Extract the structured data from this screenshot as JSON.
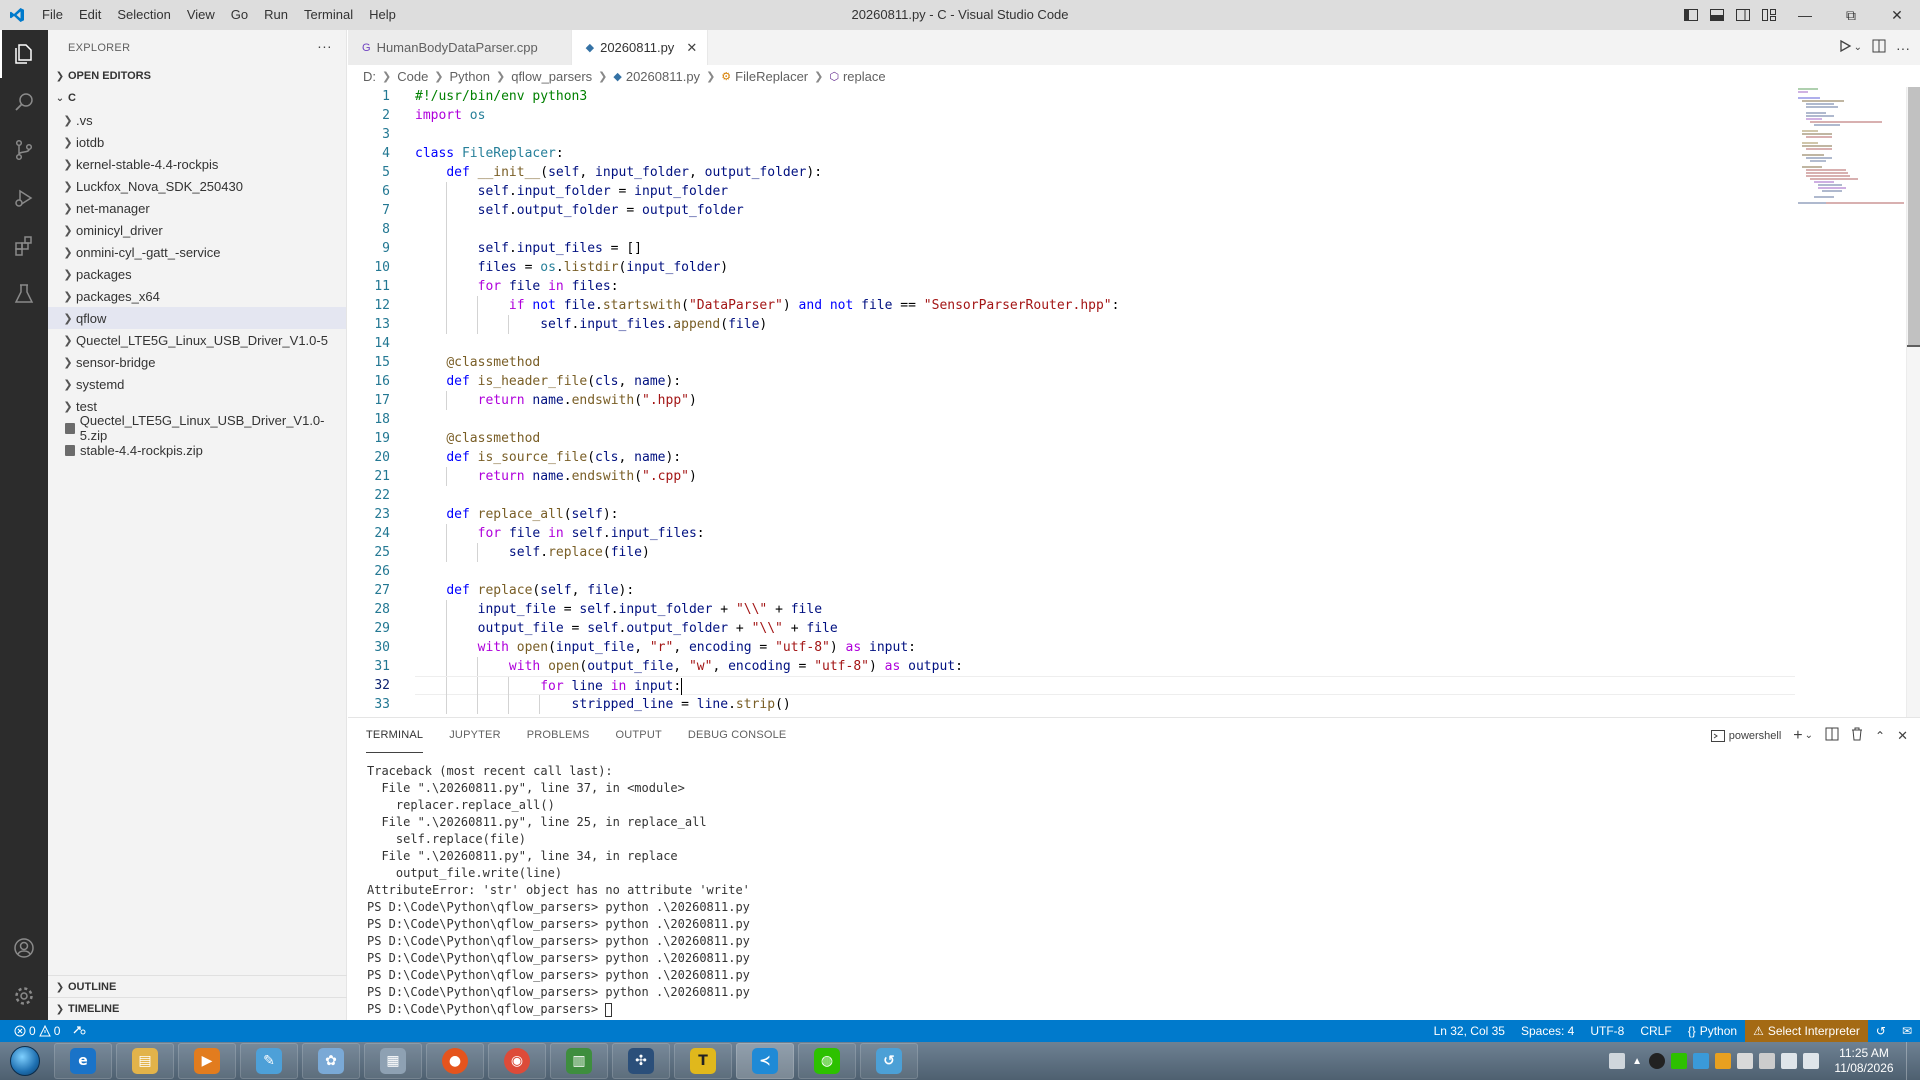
{
  "window": {
    "title": "20260811.py - C - Visual Studio Code",
    "menu": [
      "File",
      "Edit",
      "Selection",
      "View",
      "Go",
      "Run",
      "Terminal",
      "Help"
    ]
  },
  "activity_bar": {
    "items": [
      "files-icon",
      "search-icon",
      "source-control-icon",
      "run-debug-icon",
      "extensions-icon",
      "testing-icon"
    ],
    "bottom": [
      "account-icon",
      "manage-gear-icon"
    ]
  },
  "sidebar": {
    "title": "EXPLORER",
    "more": "···",
    "open_editors": "OPEN EDITORS",
    "root": "C",
    "items": [
      {
        "label": ".vs",
        "type": "folder"
      },
      {
        "label": "iotdb",
        "type": "folder"
      },
      {
        "label": "kernel-stable-4.4-rockpis",
        "type": "folder"
      },
      {
        "label": "Luckfox_Nova_SDK_250430",
        "type": "folder"
      },
      {
        "label": "net-manager",
        "type": "folder"
      },
      {
        "label": "ominicyl_driver",
        "type": "folder"
      },
      {
        "label": "onmini-cyl_-gatt_-service",
        "type": "folder"
      },
      {
        "label": "packages",
        "type": "folder"
      },
      {
        "label": "packages_x64",
        "type": "folder"
      },
      {
        "label": "qflow",
        "type": "folder",
        "selected": true
      },
      {
        "label": "Quectel_LTE5G_Linux_USB_Driver_V1.0-5",
        "type": "folder"
      },
      {
        "label": "sensor-bridge",
        "type": "folder"
      },
      {
        "label": "systemd",
        "type": "folder"
      },
      {
        "label": "test",
        "type": "folder"
      },
      {
        "label": "Quectel_LTE5G_Linux_USB_Driver_V1.0-5.zip",
        "type": "file"
      },
      {
        "label": "stable-4.4-rockpis.zip",
        "type": "file"
      }
    ],
    "outline": "OUTLINE",
    "timeline": "TIMELINE"
  },
  "tabs": [
    {
      "label": "HumanBodyDataParser.cpp",
      "active": false,
      "icon": "G"
    },
    {
      "label": "20260811.py",
      "active": true,
      "icon": "◆",
      "close": "✕"
    }
  ],
  "breadcrumb": [
    "D:",
    "Code",
    "Python",
    "qflow_parsers",
    "20260811.py",
    "FileReplacer",
    "replace"
  ],
  "editor": {
    "line_numbers": [
      "1",
      "2",
      "3",
      "4",
      "5",
      "6",
      "7",
      "8",
      "9",
      "10",
      "11",
      "12",
      "13",
      "14",
      "15",
      "16",
      "17",
      "18",
      "19",
      "20",
      "21",
      "22",
      "23",
      "24",
      "25",
      "26",
      "27",
      "28",
      "29",
      "30",
      "31",
      "32",
      "33"
    ],
    "current_line": 32
  },
  "panel": {
    "tabs": [
      "TERMINAL",
      "JUPYTER",
      "PROBLEMS",
      "OUTPUT",
      "DEBUG CONSOLE"
    ],
    "shell": "powershell",
    "terminal_lines": [
      "Traceback (most recent call last):",
      "  File \".\\20260811.py\", line 37, in <module>",
      "    replacer.replace_all()",
      "  File \".\\20260811.py\", line 25, in replace_all",
      "    self.replace(file)",
      "  File \".\\20260811.py\", line 34, in replace",
      "    output_file.write(line)",
      "AttributeError: 'str' object has no attribute 'write'",
      "PS D:\\Code\\Python\\qflow_parsers> python .\\20260811.py",
      "PS D:\\Code\\Python\\qflow_parsers> python .\\20260811.py",
      "PS D:\\Code\\Python\\qflow_parsers> python .\\20260811.py",
      "PS D:\\Code\\Python\\qflow_parsers> python .\\20260811.py",
      "PS D:\\Code\\Python\\qflow_parsers> python .\\20260811.py",
      "PS D:\\Code\\Python\\qflow_parsers> python .\\20260811.py"
    ],
    "prompt": "PS D:\\Code\\Python\\qflow_parsers> "
  },
  "status": {
    "errors": "0",
    "warnings": "0",
    "position": "Ln 32, Col 35",
    "spaces": "Spaces: 4",
    "encoding": "UTF-8",
    "eol": "CRLF",
    "language": "Python",
    "interpreter": "Select Interpreter"
  },
  "taskbar": {
    "apps": [
      {
        "name": "internet-explorer",
        "color": "#1a73c8",
        "glyph": "e"
      },
      {
        "name": "file-explorer",
        "color": "#e2b34a",
        "glyph": "▤"
      },
      {
        "name": "media-player",
        "color": "#e27c1e",
        "glyph": "▶"
      },
      {
        "name": "notepad",
        "color": "#4da0d8",
        "glyph": "✎"
      },
      {
        "name": "paint",
        "color": "#7aa9d6",
        "glyph": "✿"
      },
      {
        "name": "calculator",
        "color": "#8ea1b3",
        "glyph": "▦"
      },
      {
        "name": "firefox",
        "color": "#e5541d",
        "glyph": "●"
      },
      {
        "name": "chrome",
        "color": "#dd4b39",
        "glyph": "◉"
      },
      {
        "name": "chart-app",
        "color": "#3e8e3e",
        "glyph": "▥"
      },
      {
        "name": "network-app",
        "color": "#2b4f7a",
        "glyph": "✣"
      },
      {
        "name": "typora",
        "color": "#e0b81c",
        "glyph": "T"
      },
      {
        "name": "vscode",
        "color": "#1f8ad6",
        "glyph": "≺"
      },
      {
        "name": "wechat",
        "color": "#2dc100",
        "glyph": "◍"
      },
      {
        "name": "remote-app",
        "color": "#4ca0d6",
        "glyph": "↺"
      }
    ],
    "time": "11:25 AM",
    "date": "11/08/2026"
  },
  "colors": {
    "accent": "#007acc",
    "activity_bar": "#2c2c2c",
    "warning_bg": "#a46a14"
  }
}
